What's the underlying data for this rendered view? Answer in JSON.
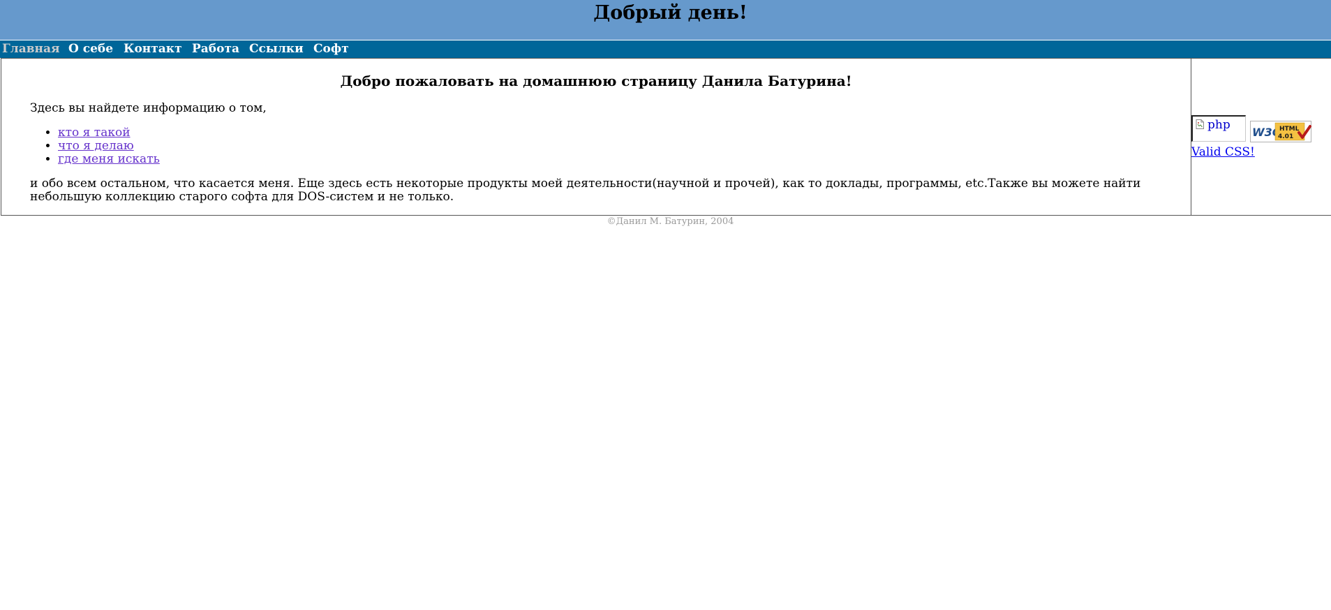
{
  "header": {
    "title": "Добрый день!",
    "background": "#6699cc"
  },
  "nav": {
    "background": "#006699",
    "items": [
      {
        "label": "Главная",
        "active": true
      },
      {
        "label": "О себе"
      },
      {
        "label": "Контакт"
      },
      {
        "label": "Работа"
      },
      {
        "label": "Ссылки"
      },
      {
        "label": "Софт"
      }
    ]
  },
  "main": {
    "heading": "Добро пожаловать на домашнюю страницу Данила Батурина!",
    "intro": "Здесь вы найдете информацию о том,",
    "links": [
      "кто я такой",
      "что я делаю",
      "где меня искать"
    ],
    "outro": "и обо всем остальном, что касается меня. Еще здесь есть некоторые продукты моей деятельности(научной и прочей), как то доклады, программы, etc.Также вы можете найти небольшую коллекцию старого софта для DOS-систем и не только."
  },
  "sidebar": {
    "php_badge_text": "php",
    "php_badge_icon": "broken-image-icon",
    "w3c_badge_icon": "w3c-html401-valid-badge",
    "w3c_badge_text": "HTML 4.01",
    "valid_css_label": "Valid CSS!"
  },
  "footer": {
    "copyright": "©Данил М. Батурин, 2004"
  }
}
